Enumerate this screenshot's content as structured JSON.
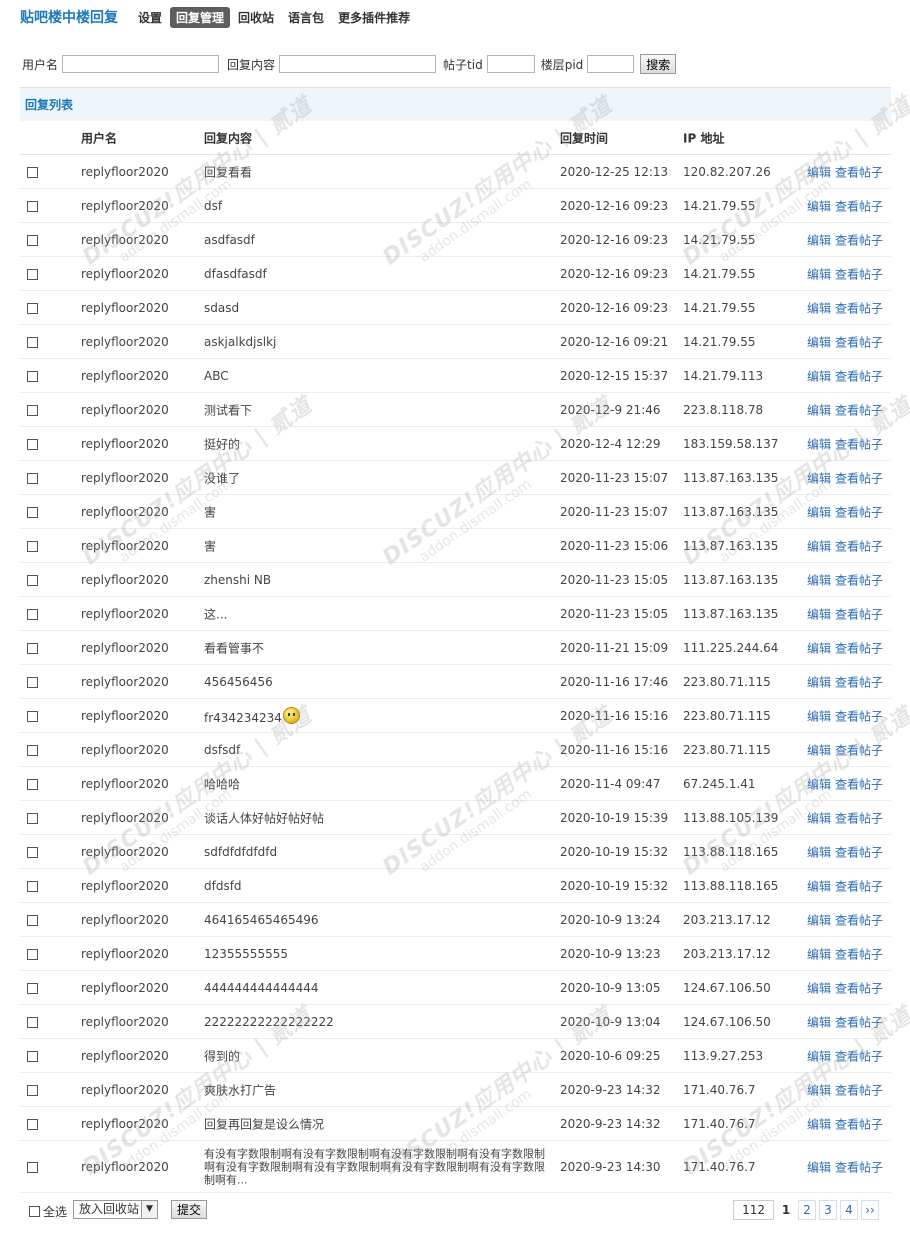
{
  "app": {
    "title": "贴吧楼中楼回复",
    "nav": [
      {
        "label": "设置",
        "active": false
      },
      {
        "label": "回复管理",
        "active": true
      },
      {
        "label": "回收站",
        "active": false
      },
      {
        "label": "语言包",
        "active": false
      },
      {
        "label": "更多插件推荐",
        "active": false
      }
    ]
  },
  "search": {
    "username_label": "用户名",
    "content_label": "回复内容",
    "tid_label": "帖子tid",
    "pid_label": "楼层pid",
    "button": "搜索"
  },
  "section": {
    "title": "回复列表"
  },
  "table": {
    "headers": {
      "username": "用户名",
      "content": "回复内容",
      "time": "回复时间",
      "ip": "IP 地址"
    },
    "ops": {
      "edit": "编辑",
      "view": "查看帖子"
    },
    "rows": [
      {
        "user": "replyfloor2020",
        "content": "回复看看",
        "time": "2020-12-25 12:13",
        "ip": "120.82.207.26"
      },
      {
        "user": "replyfloor2020",
        "content": "dsf",
        "time": "2020-12-16 09:23",
        "ip": "14.21.79.55"
      },
      {
        "user": "replyfloor2020",
        "content": "asdfasdf",
        "time": "2020-12-16 09:23",
        "ip": "14.21.79.55"
      },
      {
        "user": "replyfloor2020",
        "content": "dfasdfasdf",
        "time": "2020-12-16 09:23",
        "ip": "14.21.79.55"
      },
      {
        "user": "replyfloor2020",
        "content": "sdasd",
        "time": "2020-12-16 09:23",
        "ip": "14.21.79.55"
      },
      {
        "user": "replyfloor2020",
        "content": "askjalkdjslkj",
        "time": "2020-12-16 09:21",
        "ip": "14.21.79.55"
      },
      {
        "user": "replyfloor2020",
        "content": "ABC",
        "time": "2020-12-15 15:37",
        "ip": "14.21.79.113"
      },
      {
        "user": "replyfloor2020",
        "content": "测试看下",
        "time": "2020-12-9 21:46",
        "ip": "223.8.118.78"
      },
      {
        "user": "replyfloor2020",
        "content": "挺好的",
        "time": "2020-12-4 12:29",
        "ip": "183.159.58.137"
      },
      {
        "user": "replyfloor2020",
        "content": "没谁了",
        "time": "2020-11-23 15:07",
        "ip": "113.87.163.135"
      },
      {
        "user": "replyfloor2020",
        "content": "害",
        "time": "2020-11-23 15:07",
        "ip": "113.87.163.135"
      },
      {
        "user": "replyfloor2020",
        "content": "害",
        "time": "2020-11-23 15:06",
        "ip": "113.87.163.135"
      },
      {
        "user": "replyfloor2020",
        "content": "zhenshi NB",
        "time": "2020-11-23 15:05",
        "ip": "113.87.163.135"
      },
      {
        "user": "replyfloor2020",
        "content": "这...",
        "time": "2020-11-23 15:05",
        "ip": "113.87.163.135"
      },
      {
        "user": "replyfloor2020",
        "content": "看看管事不",
        "time": "2020-11-21 15:09",
        "ip": "111.225.244.64"
      },
      {
        "user": "replyfloor2020",
        "content": "456456456",
        "time": "2020-11-16 17:46",
        "ip": "223.80.71.115"
      },
      {
        "user": "replyfloor2020",
        "content": "fr434234234",
        "emoji": true,
        "time": "2020-11-16 15:16",
        "ip": "223.80.71.115"
      },
      {
        "user": "replyfloor2020",
        "content": "dsfsdf",
        "time": "2020-11-16 15:16",
        "ip": "223.80.71.115"
      },
      {
        "user": "replyfloor2020",
        "content": "哈哈哈",
        "time": "2020-11-4 09:47",
        "ip": "67.245.1.41"
      },
      {
        "user": "replyfloor2020",
        "content": "谈话人体好帖好帖好帖",
        "time": "2020-10-19 15:39",
        "ip": "113.88.105.139"
      },
      {
        "user": "replyfloor2020",
        "content": "sdfdfdfdfdfd",
        "time": "2020-10-19 15:32",
        "ip": "113.88.118.165"
      },
      {
        "user": "replyfloor2020",
        "content": "dfdsfd",
        "time": "2020-10-19 15:32",
        "ip": "113.88.118.165"
      },
      {
        "user": "replyfloor2020",
        "content": "464165465465496",
        "time": "2020-10-9 13:24",
        "ip": "203.213.17.12"
      },
      {
        "user": "replyfloor2020",
        "content": "12355555555",
        "time": "2020-10-9 13:23",
        "ip": "203.213.17.12"
      },
      {
        "user": "replyfloor2020",
        "content": "444444444444444",
        "time": "2020-10-9 13:05",
        "ip": "124.67.106.50"
      },
      {
        "user": "replyfloor2020",
        "content": "22222222222222222",
        "time": "2020-10-9 13:04",
        "ip": "124.67.106.50"
      },
      {
        "user": "replyfloor2020",
        "content": "得到的",
        "time": "2020-10-6 09:25",
        "ip": "113.9.27.253"
      },
      {
        "user": "replyfloor2020",
        "content": "爽肤水打广告",
        "time": "2020-9-23 14:32",
        "ip": "171.40.76.7"
      },
      {
        "user": "replyfloor2020",
        "content": "回复再回复是设么情况",
        "time": "2020-9-23 14:32",
        "ip": "171.40.76.7"
      },
      {
        "user": "replyfloor2020",
        "content": "有没有字数限制啊有没有字数限制啊有没有字数限制啊有没有字数限制啊有没有字数限制啊有没有字数限制啊有没有字数限制啊有没有字数限制啊有...",
        "tall": true,
        "time": "2020-9-23 14:30",
        "ip": "171.40.76.7"
      }
    ]
  },
  "footer": {
    "select_all": "全选",
    "action_value": "放入回收站",
    "submit": "提交",
    "pager": {
      "total": "112",
      "current": "1",
      "pages": [
        "2",
        "3",
        "4"
      ],
      "next": "››"
    }
  },
  "watermark": {
    "line1": "DISCUZ!应用中心 | 贰道",
    "line2": "addon.dismall.com"
  }
}
